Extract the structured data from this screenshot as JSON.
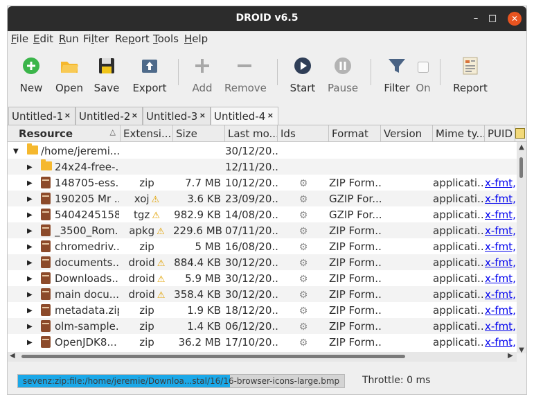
{
  "window": {
    "title": "DROID v6.5",
    "min": "–",
    "max": "□",
    "close": "✕"
  },
  "menu": [
    {
      "u": "F",
      "rest": "ile"
    },
    {
      "u": "E",
      "rest": "dit"
    },
    {
      "u": "R",
      "rest": "un"
    },
    {
      "pre": "Fi",
      "u": "l",
      "rest": "ter"
    },
    {
      "pre": "Re",
      "u": "p",
      "rest": "ort"
    },
    {
      "u": "T",
      "rest": "ools"
    },
    {
      "u": "H",
      "rest": "elp"
    }
  ],
  "toolbar": {
    "new": "New",
    "open": "Open",
    "save": "Save",
    "export": "Export",
    "add": "Add",
    "remove": "Remove",
    "start": "Start",
    "pause": "Pause",
    "filter": "Filter",
    "on": "On",
    "report": "Report"
  },
  "tabs": [
    "Untitled-1",
    "Untitled-2",
    "Untitled-3",
    "Untitled-4"
  ],
  "tab_close": "×",
  "columns": [
    "Resource",
    "Extensi...",
    "Size",
    "Last mo...",
    "Ids",
    "Format",
    "Version",
    "Mime ty...",
    "PUID"
  ],
  "rows": [
    {
      "name": "/home/jeremi...",
      "ext": "",
      "warn": false,
      "size": "",
      "date": "30/12/20...",
      "ids": false,
      "format": "",
      "mime": "",
      "puid": "",
      "kind": "folder",
      "level": 0,
      "expander": "▼"
    },
    {
      "name": "24x24-free-...",
      "ext": "",
      "warn": false,
      "size": "",
      "date": "12/11/20...",
      "ids": false,
      "format": "",
      "mime": "",
      "puid": "",
      "kind": "folder",
      "level": 1,
      "expander": "▶"
    },
    {
      "name": "148705-ess...",
      "ext": "zip",
      "warn": false,
      "size": "7.7 MB",
      "date": "10/12/20...",
      "ids": true,
      "format": "ZIP Form...",
      "mime": "applicati...",
      "puid": "x-fmt,",
      "kind": "archive",
      "level": 1,
      "expander": "▶"
    },
    {
      "name": "190205 Mr ...",
      "ext": "xoj",
      "warn": true,
      "size": "3.6 KB",
      "date": "23/09/20...",
      "ids": true,
      "format": "GZIP For...",
      "mime": "applicati...",
      "puid": "x-fmt,",
      "kind": "archive",
      "level": 1,
      "expander": "▶"
    },
    {
      "name": "5404245158...",
      "ext": "tgz",
      "warn": true,
      "size": "982.9 KB",
      "date": "14/08/20...",
      "ids": true,
      "format": "GZIP For...",
      "mime": "applicati...",
      "puid": "x-fmt,",
      "kind": "archive",
      "level": 1,
      "expander": "▶"
    },
    {
      "name": "_3500_Rom...",
      "ext": "apkg",
      "warn": true,
      "size": "229.6 MB",
      "date": "07/11/20...",
      "ids": true,
      "format": "ZIP Form...",
      "mime": "applicati...",
      "puid": "x-fmt,",
      "kind": "archive",
      "level": 1,
      "expander": "▶"
    },
    {
      "name": "chromedriv...",
      "ext": "zip",
      "warn": false,
      "size": "5 MB",
      "date": "16/08/20...",
      "ids": true,
      "format": "ZIP Form...",
      "mime": "applicati...",
      "puid": "x-fmt,",
      "kind": "archive",
      "level": 1,
      "expander": "▶"
    },
    {
      "name": "documents....",
      "ext": "droid",
      "warn": true,
      "size": "884.4 KB",
      "date": "30/12/20...",
      "ids": true,
      "format": "ZIP Form...",
      "mime": "applicati...",
      "puid": "x-fmt,",
      "kind": "archive",
      "level": 1,
      "expander": "▶"
    },
    {
      "name": "Downloads....",
      "ext": "droid",
      "warn": true,
      "size": "5.9 MB",
      "date": "30/12/20...",
      "ids": true,
      "format": "ZIP Form...",
      "mime": "applicati...",
      "puid": "x-fmt,",
      "kind": "archive",
      "level": 1,
      "expander": "▶"
    },
    {
      "name": "main docu...",
      "ext": "droid",
      "warn": true,
      "size": "358.4 KB",
      "date": "30/12/20...",
      "ids": true,
      "format": "ZIP Form...",
      "mime": "applicati...",
      "puid": "x-fmt,",
      "kind": "archive",
      "level": 1,
      "expander": "▶"
    },
    {
      "name": "metadata.zip",
      "ext": "zip",
      "warn": false,
      "size": "1.9 KB",
      "date": "18/12/20...",
      "ids": true,
      "format": "ZIP Form...",
      "mime": "applicati...",
      "puid": "x-fmt,",
      "kind": "archive",
      "level": 1,
      "expander": "▶"
    },
    {
      "name": "olm-sample...",
      "ext": "zip",
      "warn": false,
      "size": "1.4 KB",
      "date": "06/12/20...",
      "ids": true,
      "format": "ZIP Form...",
      "mime": "applicati...",
      "puid": "x-fmt,",
      "kind": "archive",
      "level": 1,
      "expander": "▶"
    },
    {
      "name": "OpenJDK8...",
      "ext": "zip",
      "warn": false,
      "size": "36.2 MB",
      "date": "17/10/20...",
      "ids": true,
      "format": "ZIP Form...",
      "mime": "applicati...",
      "puid": "x-fmt,",
      "kind": "archive",
      "level": 1,
      "expander": "▶"
    }
  ],
  "status": {
    "progress_text": "sevenz:zip:file:/home/jeremie/Downloa...stal/16/16-browser-icons-large.bmp",
    "progress_fraction": 0.65,
    "throttle": "Throttle: 0 ms"
  },
  "colors": {
    "accent": "#e95420",
    "progress": "#1ba8e8",
    "new": "#3bb54a",
    "folder": "#f5b82e"
  }
}
